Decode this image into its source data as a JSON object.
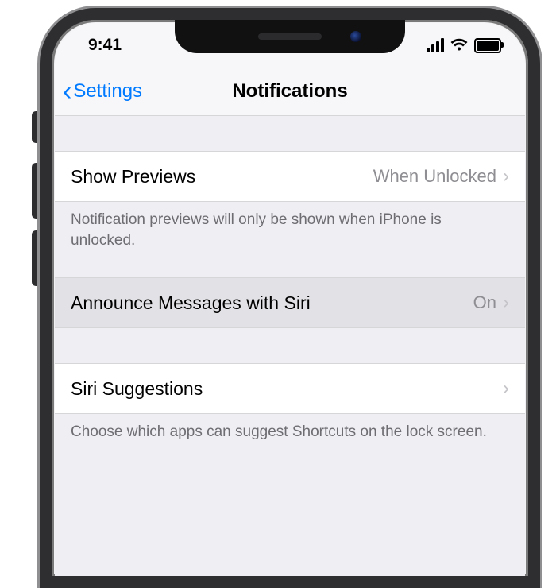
{
  "status": {
    "time": "9:41"
  },
  "nav": {
    "back_label": "Settings",
    "title": "Notifications"
  },
  "rows": {
    "show_previews": {
      "label": "Show Previews",
      "value": "When Unlocked",
      "footer": "Notification previews will only be shown when iPhone is unlocked."
    },
    "announce": {
      "label": "Announce Messages with Siri",
      "value": "On"
    },
    "siri_suggestions": {
      "label": "Siri Suggestions",
      "footer": "Choose which apps can suggest Shortcuts on the lock screen."
    }
  }
}
